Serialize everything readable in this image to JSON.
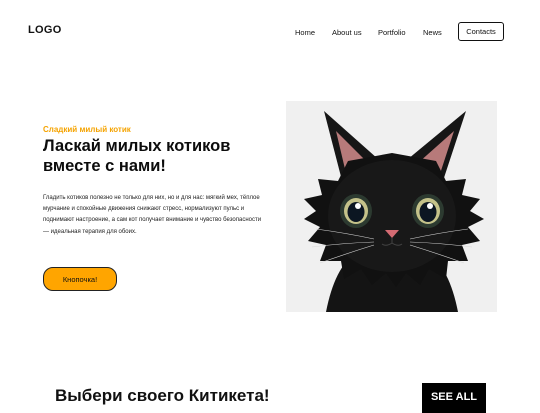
{
  "header": {
    "logo": "LOGO",
    "nav": [
      "Home",
      "About us",
      "Portfolio",
      "News"
    ],
    "contacts_button": "Contacts"
  },
  "hero": {
    "eyebrow": "Сладкий милый котик",
    "headline": "Ласкай милых котиков вместе с нами!",
    "body": "Гладить котиков полезно не только для них, но и для нас: мягкий мех, тёплое мурчание и спокойные движения снижают стресс, нормализуют пульс и поднимают настроение, а сам кот получает внимание и чувство безопасности — идеальная терапия для обоих.",
    "cta": "Кнопочка!",
    "image_subject": "black-kitten-portrait"
  },
  "section": {
    "title": "Выбери своего Китикета!",
    "see_all": "SEE ALL"
  },
  "colors": {
    "accent": "#ffa500",
    "eyebrow": "#f5a300",
    "text": "#111111",
    "image_bg": "#f0f0f0"
  }
}
